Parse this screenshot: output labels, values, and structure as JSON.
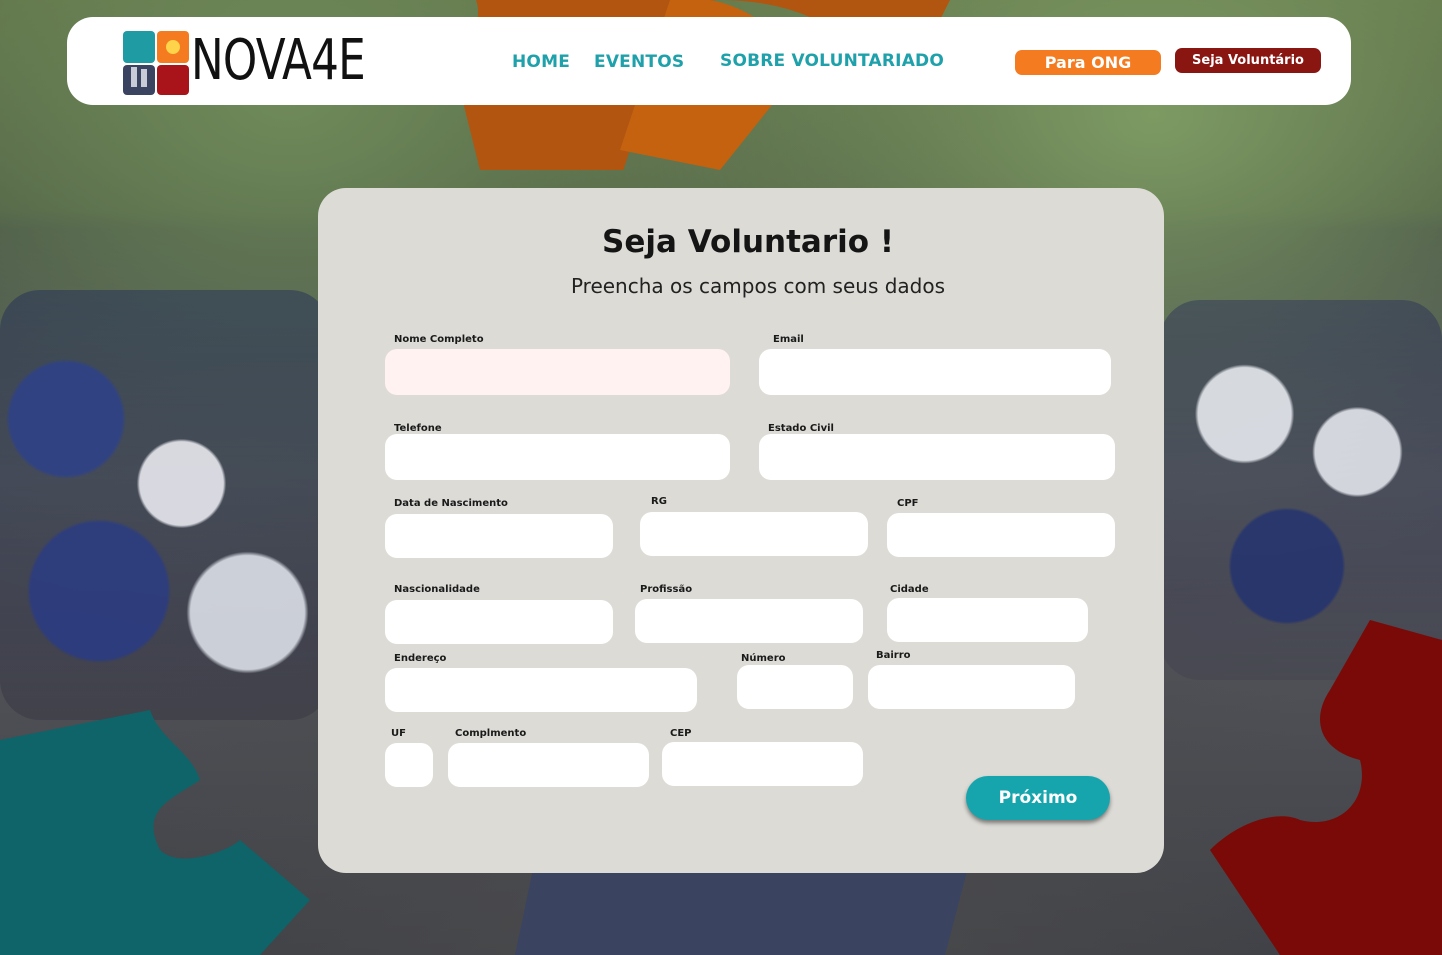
{
  "colors": {
    "brand_teal": "#1ea1aa",
    "brand_orange": "#f47b20",
    "brand_red": "#8a1612",
    "card_bg": "#dcdbd6",
    "active_field_bg": "#fff2f1"
  },
  "header": {
    "logo_text": "NOVA4E",
    "nav": {
      "home": "HOME",
      "eventos": "EVENTOS",
      "sobre": "SOBRE VOLUNTARIADO"
    },
    "btn_ong": "Para ONG",
    "btn_voluntario": "Seja Voluntário"
  },
  "form": {
    "title": "Seja Voluntario !",
    "subtitle": "Preencha os campos com seus dados",
    "labels": {
      "nome": "Nome Completo",
      "email": "Email",
      "telefone": "Telefone",
      "estado_civil": "Estado Civil",
      "nascimento": "Data de Nascimento",
      "rg": "RG",
      "cpf": "CPF",
      "nacionalidade": "Nascionalidade",
      "profissao": "Profissão",
      "cidade": "Cidade",
      "endereco": "Endereço",
      "numero": "Número",
      "bairro": "Bairro",
      "uf": "UF",
      "complemento": "Complmento",
      "cep": "CEP"
    },
    "next_button": "Próximo"
  }
}
